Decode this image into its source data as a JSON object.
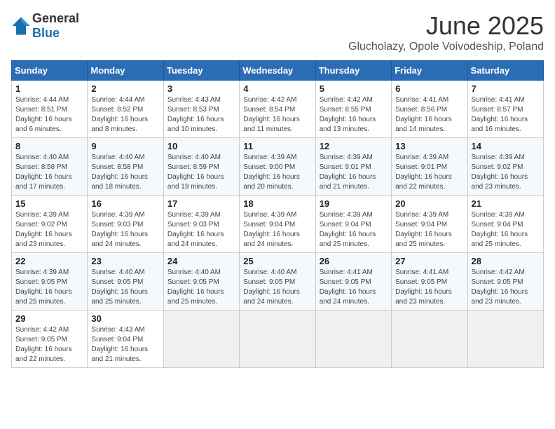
{
  "logo": {
    "general": "General",
    "blue": "Blue"
  },
  "title": {
    "month": "June 2025",
    "location": "Glucholazy, Opole Voivodeship, Poland"
  },
  "calendar": {
    "headers": [
      "Sunday",
      "Monday",
      "Tuesday",
      "Wednesday",
      "Thursday",
      "Friday",
      "Saturday"
    ],
    "weeks": [
      [
        {
          "day": "1",
          "info": "Sunrise: 4:44 AM\nSunset: 8:51 PM\nDaylight: 16 hours\nand 6 minutes."
        },
        {
          "day": "2",
          "info": "Sunrise: 4:44 AM\nSunset: 8:52 PM\nDaylight: 16 hours\nand 8 minutes."
        },
        {
          "day": "3",
          "info": "Sunrise: 4:43 AM\nSunset: 8:53 PM\nDaylight: 16 hours\nand 10 minutes."
        },
        {
          "day": "4",
          "info": "Sunrise: 4:42 AM\nSunset: 8:54 PM\nDaylight: 16 hours\nand 11 minutes."
        },
        {
          "day": "5",
          "info": "Sunrise: 4:42 AM\nSunset: 8:55 PM\nDaylight: 16 hours\nand 13 minutes."
        },
        {
          "day": "6",
          "info": "Sunrise: 4:41 AM\nSunset: 8:56 PM\nDaylight: 16 hours\nand 14 minutes."
        },
        {
          "day": "7",
          "info": "Sunrise: 4:41 AM\nSunset: 8:57 PM\nDaylight: 16 hours\nand 16 minutes."
        }
      ],
      [
        {
          "day": "8",
          "info": "Sunrise: 4:40 AM\nSunset: 8:58 PM\nDaylight: 16 hours\nand 17 minutes."
        },
        {
          "day": "9",
          "info": "Sunrise: 4:40 AM\nSunset: 8:58 PM\nDaylight: 16 hours\nand 18 minutes."
        },
        {
          "day": "10",
          "info": "Sunrise: 4:40 AM\nSunset: 8:59 PM\nDaylight: 16 hours\nand 19 minutes."
        },
        {
          "day": "11",
          "info": "Sunrise: 4:39 AM\nSunset: 9:00 PM\nDaylight: 16 hours\nand 20 minutes."
        },
        {
          "day": "12",
          "info": "Sunrise: 4:39 AM\nSunset: 9:01 PM\nDaylight: 16 hours\nand 21 minutes."
        },
        {
          "day": "13",
          "info": "Sunrise: 4:39 AM\nSunset: 9:01 PM\nDaylight: 16 hours\nand 22 minutes."
        },
        {
          "day": "14",
          "info": "Sunrise: 4:39 AM\nSunset: 9:02 PM\nDaylight: 16 hours\nand 23 minutes."
        }
      ],
      [
        {
          "day": "15",
          "info": "Sunrise: 4:39 AM\nSunset: 9:02 PM\nDaylight: 16 hours\nand 23 minutes."
        },
        {
          "day": "16",
          "info": "Sunrise: 4:39 AM\nSunset: 9:03 PM\nDaylight: 16 hours\nand 24 minutes."
        },
        {
          "day": "17",
          "info": "Sunrise: 4:39 AM\nSunset: 9:03 PM\nDaylight: 16 hours\nand 24 minutes."
        },
        {
          "day": "18",
          "info": "Sunrise: 4:39 AM\nSunset: 9:04 PM\nDaylight: 16 hours\nand 24 minutes."
        },
        {
          "day": "19",
          "info": "Sunrise: 4:39 AM\nSunset: 9:04 PM\nDaylight: 16 hours\nand 25 minutes."
        },
        {
          "day": "20",
          "info": "Sunrise: 4:39 AM\nSunset: 9:04 PM\nDaylight: 16 hours\nand 25 minutes."
        },
        {
          "day": "21",
          "info": "Sunrise: 4:39 AM\nSunset: 9:04 PM\nDaylight: 16 hours\nand 25 minutes."
        }
      ],
      [
        {
          "day": "22",
          "info": "Sunrise: 4:39 AM\nSunset: 9:05 PM\nDaylight: 16 hours\nand 25 minutes."
        },
        {
          "day": "23",
          "info": "Sunrise: 4:40 AM\nSunset: 9:05 PM\nDaylight: 16 hours\nand 25 minutes."
        },
        {
          "day": "24",
          "info": "Sunrise: 4:40 AM\nSunset: 9:05 PM\nDaylight: 16 hours\nand 25 minutes."
        },
        {
          "day": "25",
          "info": "Sunrise: 4:40 AM\nSunset: 9:05 PM\nDaylight: 16 hours\nand 24 minutes."
        },
        {
          "day": "26",
          "info": "Sunrise: 4:41 AM\nSunset: 9:05 PM\nDaylight: 16 hours\nand 24 minutes."
        },
        {
          "day": "27",
          "info": "Sunrise: 4:41 AM\nSunset: 9:05 PM\nDaylight: 16 hours\nand 23 minutes."
        },
        {
          "day": "28",
          "info": "Sunrise: 4:42 AM\nSunset: 9:05 PM\nDaylight: 16 hours\nand 23 minutes."
        }
      ],
      [
        {
          "day": "29",
          "info": "Sunrise: 4:42 AM\nSunset: 9:05 PM\nDaylight: 16 hours\nand 22 minutes."
        },
        {
          "day": "30",
          "info": "Sunrise: 4:43 AM\nSunset: 9:04 PM\nDaylight: 16 hours\nand 21 minutes."
        },
        {
          "day": "",
          "info": ""
        },
        {
          "day": "",
          "info": ""
        },
        {
          "day": "",
          "info": ""
        },
        {
          "day": "",
          "info": ""
        },
        {
          "day": "",
          "info": ""
        }
      ]
    ]
  }
}
